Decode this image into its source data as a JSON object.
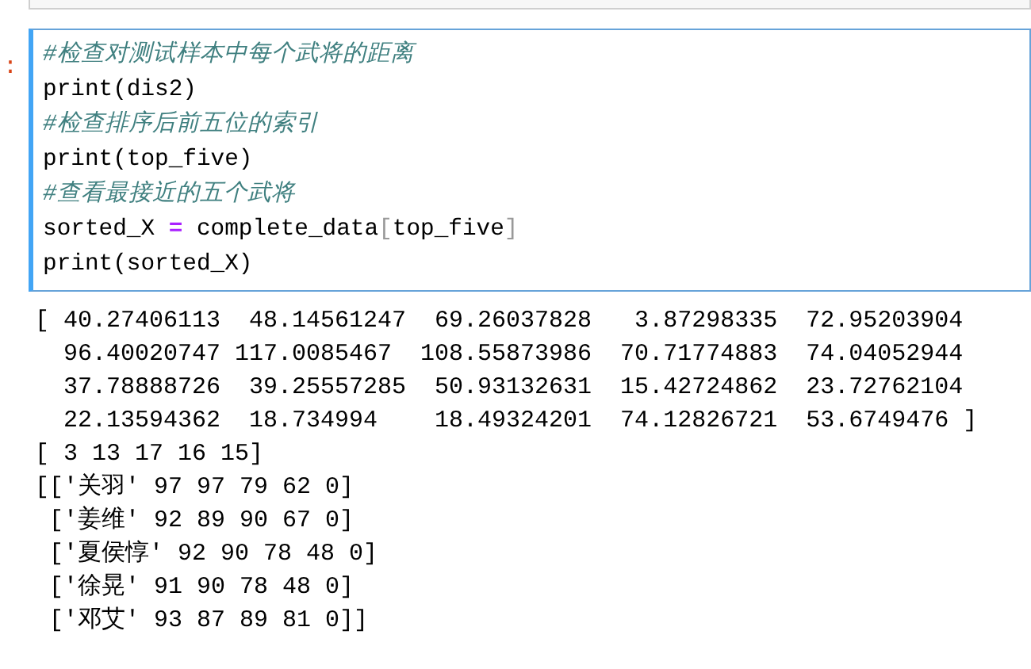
{
  "cell": {
    "prompt": ":",
    "code_lines": [
      [
        {
          "kind": "comment",
          "text": "#检查对测试样本中每个武将的距离"
        }
      ],
      [
        {
          "kind": "plain",
          "text": "print(dis2)"
        }
      ],
      [
        {
          "kind": "comment",
          "text": "#检查排序后前五位的索引"
        }
      ],
      [
        {
          "kind": "plain",
          "text": "print(top_five)"
        }
      ],
      [
        {
          "kind": "comment",
          "text": "#查看最接近的五个武将"
        }
      ],
      [
        {
          "kind": "plain",
          "text": "sorted_X "
        },
        {
          "kind": "operator",
          "text": "="
        },
        {
          "kind": "plain",
          "text": " complete_data"
        },
        {
          "kind": "bracket",
          "text": "["
        },
        {
          "kind": "plain",
          "text": "top_five"
        },
        {
          "kind": "bracket",
          "text": "]"
        }
      ],
      [
        {
          "kind": "plain",
          "text": "print(sorted_X)"
        }
      ]
    ]
  },
  "output_lines": [
    "[ 40.27406113  48.14561247  69.26037828   3.87298335  72.95203904",
    "  96.40020747 117.0085467  108.55873986  70.71774883  74.04052944",
    "  37.78888726  39.25557285  50.93132631  15.42724862  23.72762104",
    "  22.13594362  18.734994    18.49324201  74.12826721  53.6749476 ]",
    "[ 3 13 17 16 15]",
    "[['关羽' 97 97 79 62 0]",
    " ['姜维' 92 89 90 67 0]",
    " ['夏侯惇' 92 90 78 48 0]",
    " ['徐晃' 91 90 78 48 0]",
    " ['邓艾' 93 87 89 81 0]]"
  ]
}
